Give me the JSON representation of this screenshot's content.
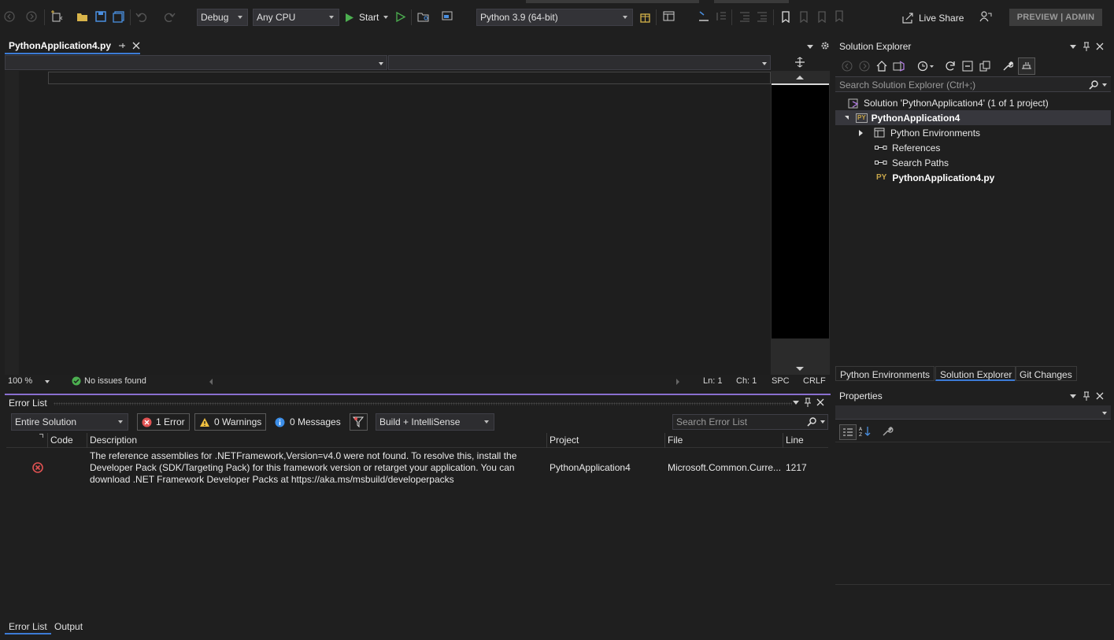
{
  "toolbar": {
    "config": "Debug",
    "platform": "Any CPU",
    "start_label": "Start",
    "interpreter": "Python 3.9 (64-bit)",
    "live_share": "Live Share",
    "preview_admin": "PREVIEW | ADMIN"
  },
  "editor": {
    "tab_label": "PythonApplication4.py",
    "zoom": "100 %",
    "issues": "No issues found",
    "line": "Ln: 1",
    "char": "Ch: 1",
    "spacing": "SPC",
    "line_ending": "CRLF"
  },
  "error_list": {
    "title": "Error List",
    "scope": "Entire Solution",
    "errors_label": "1 Error",
    "warnings_label": "0 Warnings",
    "messages_label": "0 Messages",
    "source": "Build + IntelliSense",
    "search_placeholder": "Search Error List",
    "columns": {
      "code": "Code",
      "description": "Description",
      "project": "Project",
      "file": "File",
      "line": "Line"
    },
    "rows": [
      {
        "code": "",
        "description": "The reference assemblies for .NETFramework,Version=v4.0 were not found. To resolve this, install the Developer Pack (SDK/Targeting Pack) for this framework version or retarget your application. You can download .NET Framework Developer Packs at https://aka.ms/msbuild/developerpacks",
        "project": "PythonApplication4",
        "file": "Microsoft.Common.Curre...",
        "line": "1217"
      }
    ],
    "tabs": [
      "Error List",
      "Output"
    ]
  },
  "solution_explorer": {
    "title": "Solution Explorer",
    "search_placeholder": "Search Solution Explorer (Ctrl+;)",
    "solution": "Solution 'PythonApplication4' (1 of 1 project)",
    "project": "PythonApplication4",
    "items": [
      "Python Environments",
      "References",
      "Search Paths",
      "PythonApplication4.py"
    ],
    "py_badge": "PY",
    "tabs": [
      "Python Environments",
      "Solution Explorer",
      "Git Changes"
    ]
  },
  "properties": {
    "title": "Properties"
  },
  "colors": {
    "background": "#1f1f1f",
    "accent": "#3c7bd6",
    "error": "#e05252",
    "warning": "#f0c040",
    "info": "#3c8ee8",
    "success": "#4caf50"
  }
}
